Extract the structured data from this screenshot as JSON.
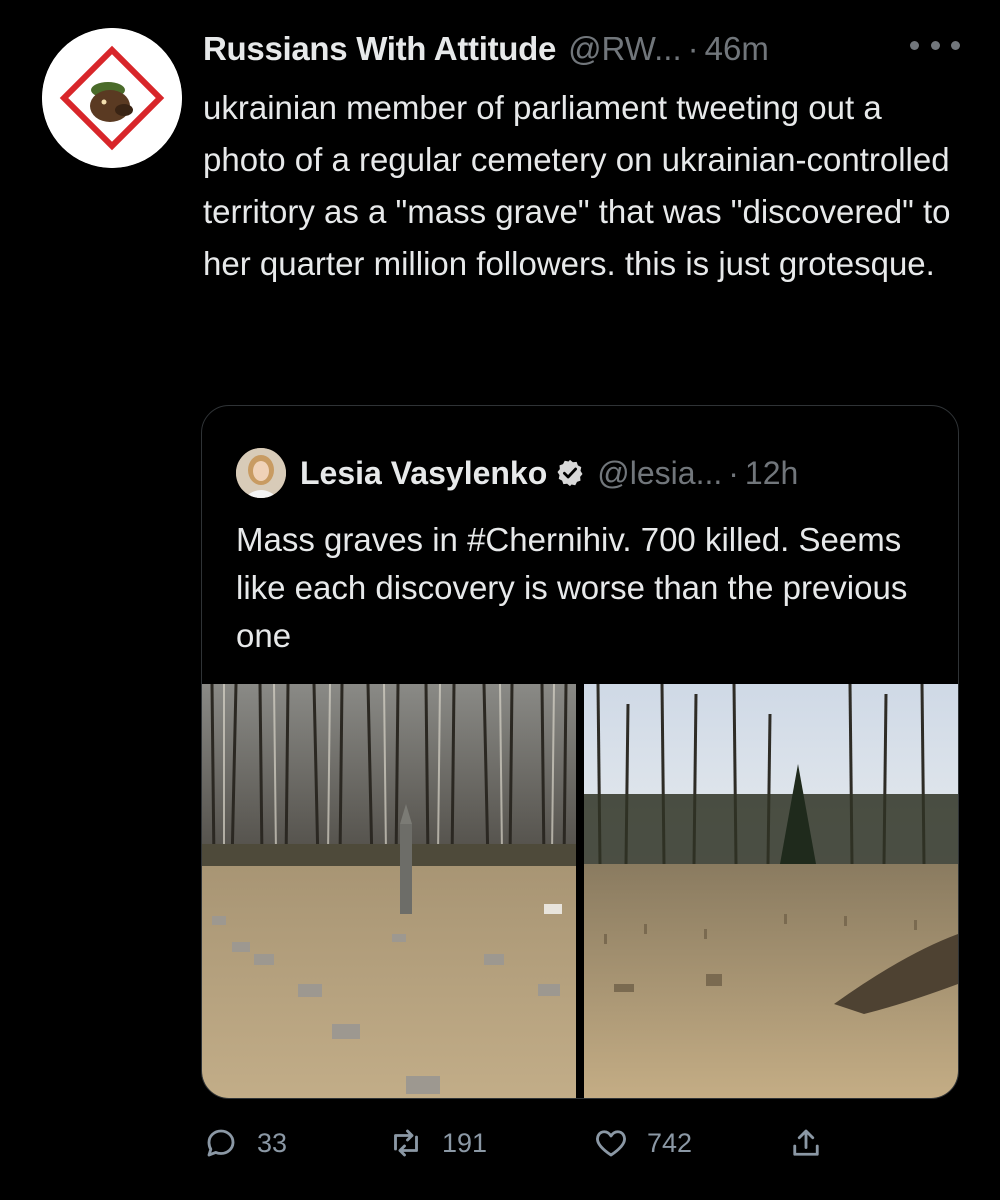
{
  "tweet": {
    "author_name": "Russians With Attitude",
    "author_handle": "@RW...",
    "dot": "·",
    "time": "46m",
    "text": "ukrainian member of parliament tweeting out a photo of a regular cemetery on ukrainian-controlled territory as a \"mass grave\" that was \"discovered\" to her quarter million followers. this is just grotesque."
  },
  "quoted": {
    "author_name": "Lesia Vasylenko",
    "author_handle": "@lesia...",
    "dot": "·",
    "time": "12h",
    "verified": true,
    "text": "Mass graves in #Chernihiv. 700 killed. Seems like each discovery is worse than the previous one"
  },
  "actions": {
    "reply_count": "33",
    "retweet_count": "191",
    "like_count": "742"
  },
  "icons": [
    "more-icon",
    "verified-icon",
    "reply-icon",
    "retweet-icon",
    "like-icon",
    "share-icon"
  ],
  "colors": {
    "background": "#000000",
    "text": "#e7e9ea",
    "secondary": "#71767b",
    "border": "#2f3336",
    "verified_badge": "#d9d9d9"
  }
}
